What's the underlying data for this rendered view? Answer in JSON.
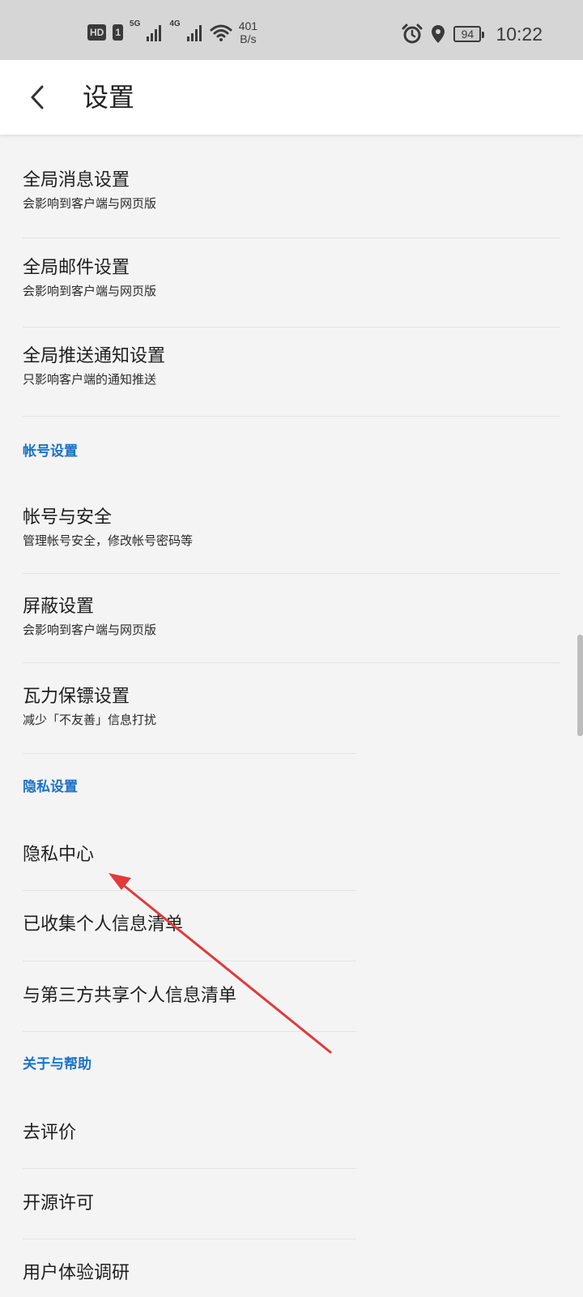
{
  "status_bar": {
    "hd_label": "HD",
    "sim_label": "1",
    "net1_label": "5G",
    "net2_label": "4G",
    "speed_value": "401",
    "speed_unit": "B/s",
    "battery_level": "94",
    "time": "10:22"
  },
  "header": {
    "title": "设置"
  },
  "general": {
    "items": [
      {
        "title": "全局消息设置",
        "subtitle": "会影响到客户端与网页版"
      },
      {
        "title": "全局邮件设置",
        "subtitle": "会影响到客户端与网页版"
      },
      {
        "title": "全局推送通知设置",
        "subtitle": "只影响客户端的通知推送"
      }
    ]
  },
  "account": {
    "header": "帐号设置",
    "items": [
      {
        "title": "帐号与安全",
        "subtitle": "管理帐号安全，修改帐号密码等"
      },
      {
        "title": "屏蔽设置",
        "subtitle": "会影响到客户端与网页版"
      },
      {
        "title": "瓦力保镖设置",
        "subtitle": "减少「不友善」信息打扰"
      }
    ]
  },
  "privacy": {
    "header": "隐私设置",
    "items": [
      {
        "title": "隐私中心"
      },
      {
        "title": "已收集个人信息清单"
      },
      {
        "title": "与第三方共享个人信息清单"
      }
    ]
  },
  "about": {
    "header": "关于与帮助",
    "items": [
      {
        "title": "去评价"
      },
      {
        "title": "开源许可"
      },
      {
        "title": "用户体验调研"
      }
    ]
  },
  "colors": {
    "section_header": "#1a73c9",
    "annotation_arrow": "#e03a3a"
  }
}
